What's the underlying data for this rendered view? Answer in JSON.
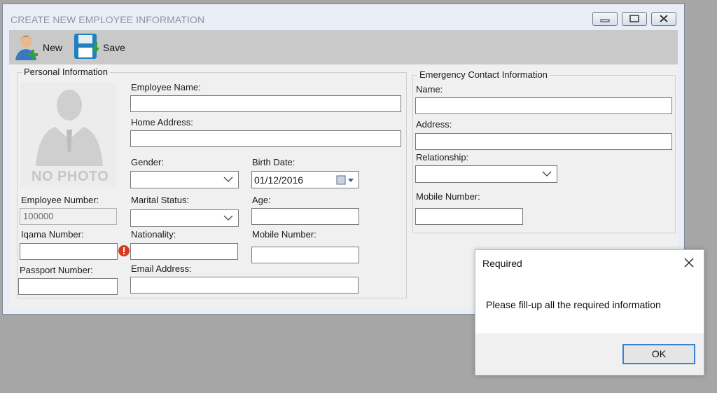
{
  "window": {
    "title": "CREATE NEW EMPLOYEE INFORMATION"
  },
  "toolbar": {
    "new_label": "New",
    "save_label": "Save"
  },
  "personal": {
    "legend": "Personal Information",
    "photo_text": "NO PHOTO",
    "employee_name_label": "Employee Name:",
    "home_address_label": "Home Address:",
    "gender_label": "Gender:",
    "birth_date_label": "Birth Date:",
    "birth_date_value": "01/12/2016",
    "employee_number_label": "Employee Number:",
    "employee_number_value": "100000",
    "marital_status_label": "Marital Status:",
    "age_label": "Age:",
    "iqama_label": "Iqama Number:",
    "nationality_label": "Nationality:",
    "mobile_label": "Mobile Number:",
    "passport_label": "Passport Number:",
    "email_label": "Email Address:"
  },
  "emergency": {
    "legend": "Emergency Contact Information",
    "name_label": "Name:",
    "address_label": "Address:",
    "relationship_label": "Relationship:",
    "mobile_label": "Mobile Number:"
  },
  "dialog": {
    "title": "Required",
    "message": "Please fill-up all the required information",
    "ok_label": "OK"
  },
  "colors": {
    "window_bg": "#e9eef6",
    "toolbar": "#c9c9c9",
    "error": "#d93a1f",
    "dialog_button_border": "#3c7fd4"
  },
  "icons": [
    "add-user-icon",
    "save-disk-icon",
    "minimize-icon",
    "maximize-icon",
    "close-icon",
    "error-icon",
    "chevron-down-icon",
    "calendar-icon"
  ]
}
